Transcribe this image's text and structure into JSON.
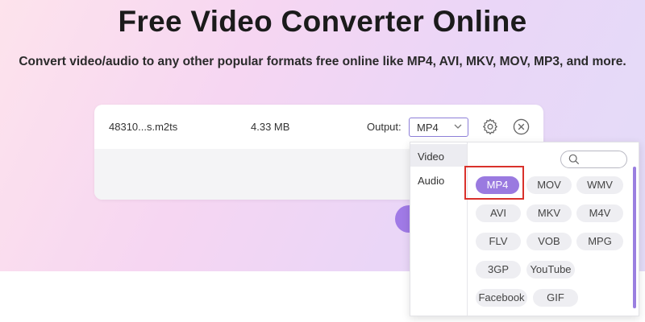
{
  "header": {
    "title": "Free Video Converter Online",
    "subtitle": "Convert video/audio to any other popular formats free online like MP4, AVI, MKV, MOV, MP3, and more."
  },
  "file": {
    "name": "48310...s.m2ts",
    "size": "4.33 MB",
    "output_label": "Output:",
    "output_value": "MP4"
  },
  "dropdown": {
    "categories": [
      {
        "label": "Video",
        "active": true
      },
      {
        "label": "Audio",
        "active": false
      }
    ],
    "selected_format": "MP4",
    "formats": [
      {
        "label": "MP4",
        "selected": true
      },
      {
        "label": "MOV",
        "selected": false
      },
      {
        "label": "WMV",
        "selected": false
      },
      {
        "label": "AVI",
        "selected": false
      },
      {
        "label": "MKV",
        "selected": false
      },
      {
        "label": "M4V",
        "selected": false
      },
      {
        "label": "FLV",
        "selected": false
      },
      {
        "label": "VOB",
        "selected": false
      },
      {
        "label": "MPG",
        "selected": false
      },
      {
        "label": "3GP",
        "selected": false
      },
      {
        "label": "YouTube",
        "selected": false
      },
      {
        "label": "Facebook",
        "selected": false
      },
      {
        "label": "GIF",
        "selected": false
      }
    ]
  },
  "icons": {
    "settings": "gear-icon",
    "close": "close-icon",
    "search": "search-icon",
    "dropdown": "chevron-down-icon"
  },
  "colors": {
    "accent": "#9a7ae0",
    "highlight": "#d9312b"
  }
}
